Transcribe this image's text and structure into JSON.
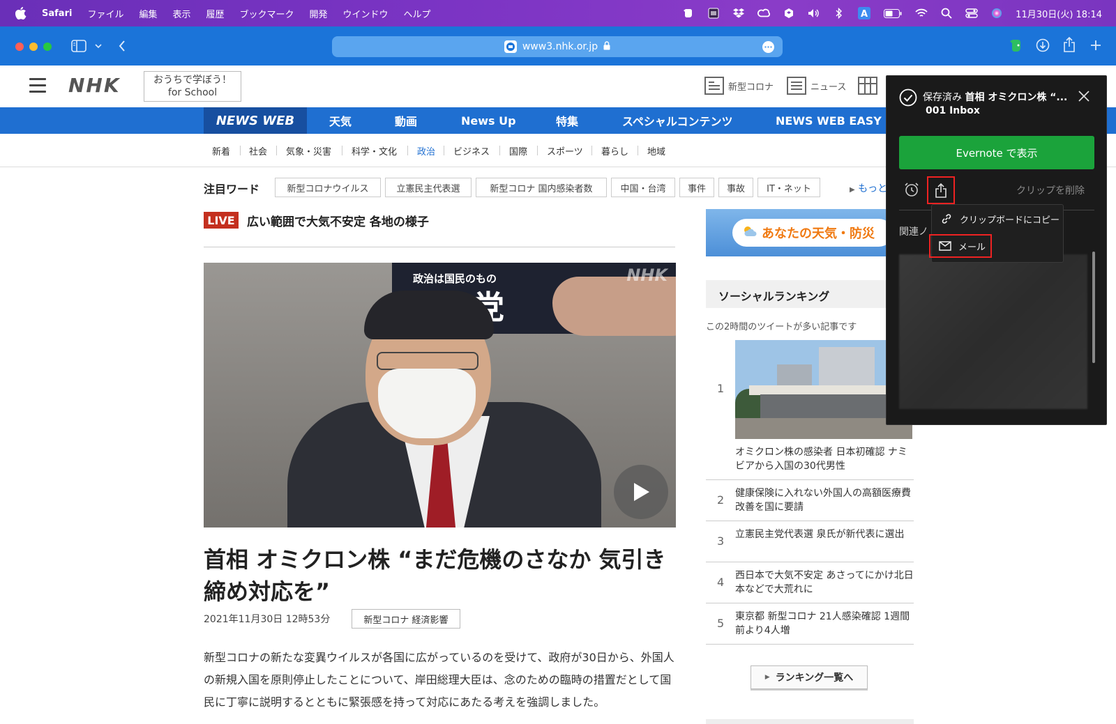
{
  "menubar": {
    "app": "Safari",
    "items": [
      "ファイル",
      "編集",
      "表示",
      "履歴",
      "ブックマーク",
      "開発",
      "ウインドウ",
      "ヘルプ"
    ],
    "clock": "11月30日(火) 18:14"
  },
  "browser": {
    "url": "www3.nhk.or.jp"
  },
  "nhk_header": {
    "logo": "NHK",
    "school_line1": "おうちで学ぼう！",
    "school_line2": "for School",
    "links": [
      "新型コロナ",
      "ニュース"
    ]
  },
  "newsnav": {
    "brand": "NEWS WEB",
    "items": [
      "天気",
      "動画",
      "News Up",
      "特集",
      "スペシャルコンテンツ",
      "NEWS WEB EASY"
    ]
  },
  "subnav": {
    "items": [
      "新着",
      "社会",
      "気象・災害",
      "科学・文化",
      "政治",
      "ビジネス",
      "国際",
      "スポーツ",
      "暮らし",
      "地域"
    ],
    "active": "政治"
  },
  "keywords": {
    "label": "注目ワード",
    "items": [
      "新型コロナウイルス",
      "立憲民主代表選",
      "新型コロナ 国内感染者数",
      "中国・台湾",
      "事件",
      "事故",
      "IT・ネット"
    ],
    "more": "もっと"
  },
  "live": {
    "badge": "LIVE",
    "text": "広い範囲で大気不安定 各地の様子"
  },
  "video": {
    "poster_small": "政治は国民のもの",
    "poster_big": "自民党",
    "watermark": "NHK"
  },
  "article": {
    "headline": "首相 オミクロン株 “まだ危機のさなか 気引き締め対応を”",
    "date": "2021年11月30日 12時53分",
    "tag": "新型コロナ 経済影響",
    "body": "新型コロナの新たな変異ウイルスが各国に広がっているのを受けて、政府が30日から、外国人の新規入国を原則停止したことについて、岸田総理大臣は、念のための臨時の措置だとして国民に丁寧に説明するとともに緊張感を持って対応にあたる考えを強調しました。"
  },
  "sidebar": {
    "weather_banner": "あなたの天気・防災",
    "ranking_title": "ソーシャルランキング",
    "ranking_sub": "この2時間のツイートが多い記事です",
    "ranking": [
      {
        "rank": "1",
        "title": "オミクロン株の感染者 日本初確認 ナミビアから入国の30代男性"
      },
      {
        "rank": "2",
        "title": "健康保険に入れない外国人の高額医療費 改善を国に要請"
      },
      {
        "rank": "3",
        "title": "立憲民主党代表選 泉氏が新代表に選出"
      },
      {
        "rank": "4",
        "title": "西日本で大気不安定 あさってにかけ北日本などで大荒れに"
      },
      {
        "rank": "5",
        "title": "東京都 新型コロナ 21人感染確認 1週間前より4人増"
      }
    ],
    "ranking_button": "ランキング一覧へ"
  },
  "evernote": {
    "saved_prefix": "保存済み",
    "saved_title": "首相 オミクロン株 “...",
    "notebook": "001 Inbox",
    "open_button": "Evernote で表示",
    "delete_clip": "クリップを削除",
    "related": "関連ノ",
    "menu": {
      "copy": "クリップボードにコピー",
      "mail": "メール"
    }
  },
  "colors": {
    "menubar": "#7b34c4",
    "safari_toolbar": "#1b74d9",
    "nhk_nav": "#1f6fd1",
    "live": "#c4301f",
    "evernote_green": "#1ba33b",
    "highlight": "#ee2222"
  }
}
